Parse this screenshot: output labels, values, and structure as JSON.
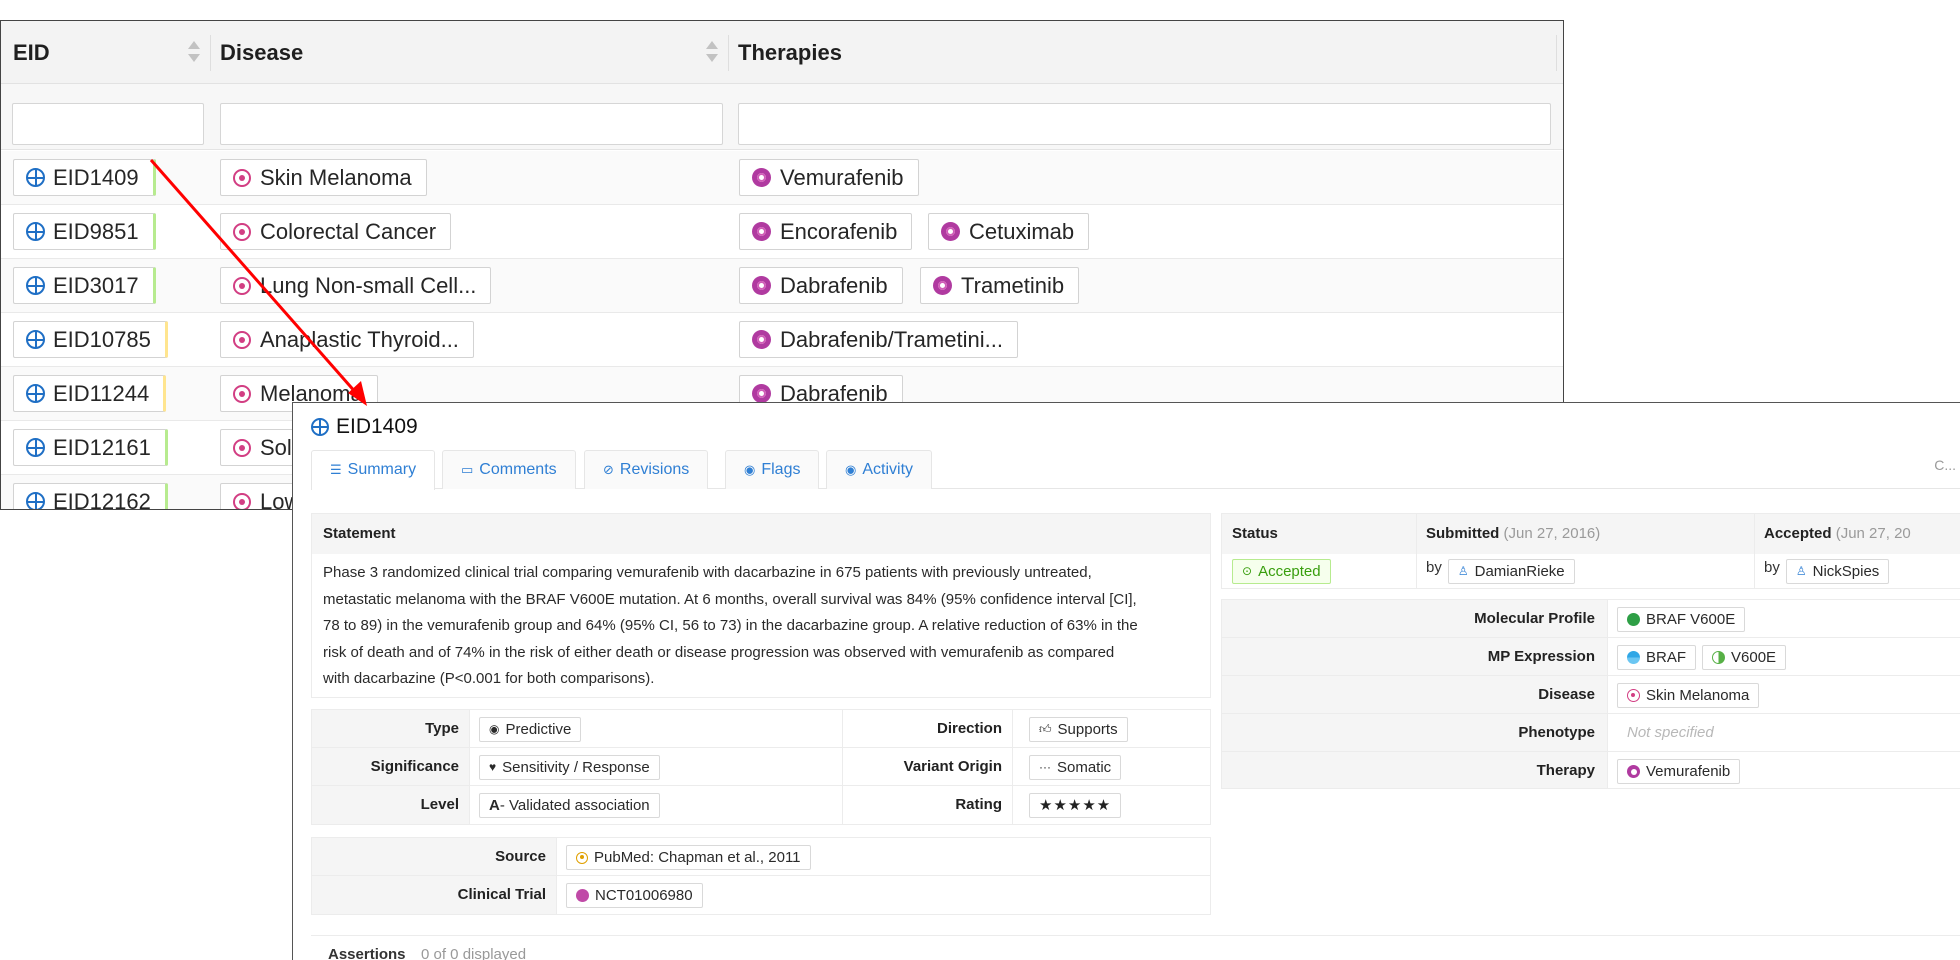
{
  "table": {
    "columns": [
      {
        "key": "eid",
        "title": "EID"
      },
      {
        "key": "disease",
        "title": "Disease"
      },
      {
        "key": "therapies",
        "title": "Therapies"
      }
    ],
    "rows": [
      {
        "eid": "EID1409",
        "disease": "Skin Melanoma",
        "therapies": [
          "Vemurafenib"
        ],
        "rating_color": "green"
      },
      {
        "eid": "EID9851",
        "disease": "Colorectal Cancer",
        "therapies": [
          "Encorafenib",
          "Cetuximab"
        ],
        "rating_color": "green"
      },
      {
        "eid": "EID3017",
        "disease": "Lung Non-small Cell...",
        "therapies": [
          "Dabrafenib",
          "Trametinib"
        ],
        "rating_color": "green"
      },
      {
        "eid": "EID10785",
        "disease": "Anaplastic Thyroid...",
        "therapies": [
          "Dabrafenib/Trametini..."
        ],
        "rating_color": "yellow"
      },
      {
        "eid": "EID11244",
        "disease": "Melanoma",
        "therapies": [
          "Dabrafenib"
        ],
        "rating_color": "yellow"
      },
      {
        "eid": "EID12161",
        "disease": "Sol",
        "therapies": [],
        "rating_color": "green"
      },
      {
        "eid": "EID12162",
        "disease": "Low",
        "therapies": [],
        "rating_color": "green"
      }
    ]
  },
  "detail": {
    "title": "EID1409",
    "tabs": [
      {
        "label": "Summary",
        "icon": "summary-icon",
        "active": true
      },
      {
        "label": "Comments",
        "icon": "comment-icon",
        "active": false
      },
      {
        "label": "Revisions",
        "icon": "revision-icon",
        "active": false
      },
      {
        "label": "Flags",
        "icon": "flag-icon",
        "active": false
      },
      {
        "label": "Activity",
        "icon": "activity-icon",
        "active": false
      }
    ],
    "tabs_overflow": "C...",
    "statement_heading": "Statement",
    "statement_lines": [
      "Phase 3 randomized clinical trial comparing vemurafenib with dacarbazine in 675 patients with previously untreated,",
      "metastatic melanoma with the BRAF V600E mutation. At 6 months, overall survival was 84% (95% confidence interval [CI],",
      "78 to 89) in the vemurafenib group and 64% (95% CI, 56 to 73) in the dacarbazine group. A relative reduction of 63% in the",
      "risk of death and of 74% in the risk of either death or disease progression was observed with vemurafenib as compared",
      "with dacarbazine (P<0.001 for both comparisons)."
    ],
    "attributes": {
      "type_label": "Type",
      "type_value": "Predictive",
      "direction_label": "Direction",
      "direction_value": "Supports",
      "significance_label": "Significance",
      "significance_value": "Sensitivity / Response",
      "origin_label": "Variant Origin",
      "origin_value": "Somatic",
      "level_label": "Level",
      "level_code": "A",
      "level_value": " - Validated association",
      "rating_label": "Rating",
      "rating_value": "★★★★★"
    },
    "source": {
      "source_label": "Source",
      "source_value": "PubMed: Chapman et al., 2011",
      "trial_label": "Clinical Trial",
      "trial_value": "NCT01006980"
    },
    "assertions": {
      "label": "Assertions",
      "count": "0 of 0 displayed"
    },
    "status": {
      "status_label": "Status",
      "status_value": "Accepted",
      "submitted_label": "Submitted",
      "submitted_date": "(Jun 27, 2016)",
      "submitted_by": "DamianRieke",
      "accepted_label": "Accepted",
      "accepted_date": "(Jun 27, 20",
      "accepted_by": "NickSpies",
      "by": "by"
    },
    "properties": {
      "mp_label": "Molecular Profile",
      "mp_value": "BRAF V600E",
      "mpexp_label": "MP Expression",
      "mpexp_gene": "BRAF",
      "mpexp_variant": "V600E",
      "disease_label": "Disease",
      "disease_value": "Skin Melanoma",
      "phenotype_label": "Phenotype",
      "phenotype_value": "Not specified",
      "therapy_label": "Therapy",
      "therapy_value": "Vemurafenib"
    }
  },
  "colors": {
    "accent": "#2f7fd4",
    "disease": "#d23e83",
    "therapy": "#b03aa0",
    "arrow": "#ff0000",
    "rating_green": "#b7eb8f",
    "rating_yellow": "#ffe58f"
  }
}
